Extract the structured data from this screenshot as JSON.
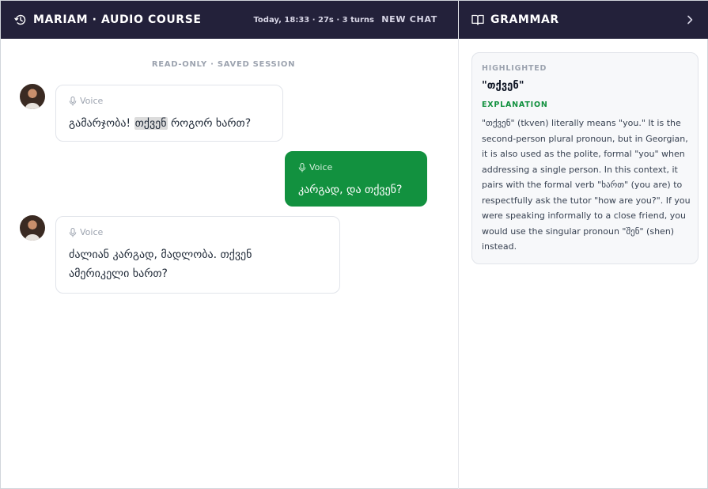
{
  "header": {
    "title": "MARIAM · AUDIO COURSE",
    "session_meta": "Today, 18:33 · 27s · 3 turns",
    "new_chat_label": "NEW CHAT"
  },
  "chat": {
    "status": "READ-ONLY · SAVED SESSION",
    "voice_label": "Voice",
    "messages": [
      {
        "role": "tutor",
        "text_before": "გამარჯობა! ",
        "highlight": "თქვენ",
        "text_after": " როგორ ხართ?"
      },
      {
        "role": "user",
        "text": "კარგად, და თქვენ?"
      },
      {
        "role": "tutor",
        "text": "ძალიან კარგად, მადლობა. თქვენ ამერიკელი ხართ?"
      }
    ]
  },
  "grammar": {
    "title": "GRAMMAR",
    "highlighted_label": "HIGHLIGHTED",
    "term": "\"თქვენ\"",
    "explanation_label": "EXPLANATION",
    "explanation": "\"თქვენ\" (tkven) literally means \"you.\" It is the second-person plural pronoun, but in Georgian, it is also used as the polite, formal \"you\" when addressing a single person. In this context, it pairs with the formal verb \"ხართ\" (you are) to respectfully ask the tutor \"how are you?\". If you were speaking informally to a close friend, you would use the singular pronoun \"შენ\" (shen) instead."
  },
  "colors": {
    "header_bg": "#23213a",
    "user_bubble": "#12913f",
    "accent_green": "#12913f"
  },
  "icons": {
    "history": "history-icon",
    "microphone": "microphone-icon",
    "book": "book-icon",
    "chevron": "chevron-right-icon"
  }
}
